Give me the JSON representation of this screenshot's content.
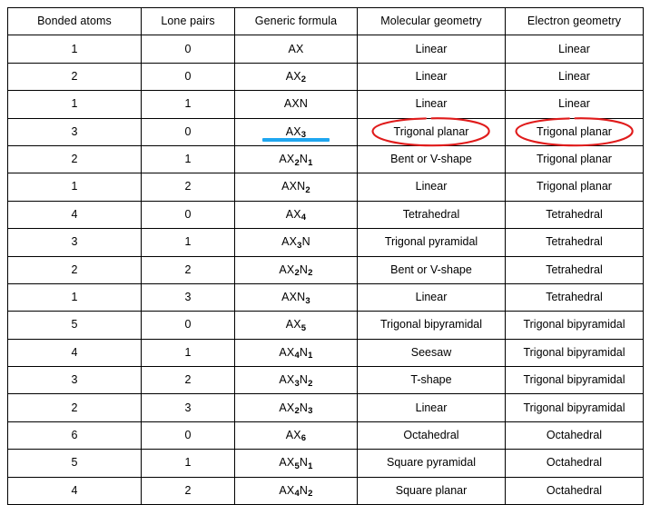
{
  "table": {
    "headers": [
      "Bonded atoms",
      "Lone pairs",
      "Generic formula",
      "Molecular geometry",
      "Electron geometry"
    ],
    "rows": [
      {
        "bonded": "1",
        "lone": "0",
        "formula_base": "AX",
        "formula_sub1": "",
        "formula_mid": "",
        "formula_sub2": "",
        "molecular": "Linear",
        "electron": "Linear"
      },
      {
        "bonded": "2",
        "lone": "0",
        "formula_base": "AX",
        "formula_sub1": "2",
        "formula_mid": "",
        "formula_sub2": "",
        "molecular": "Linear",
        "electron": "Linear"
      },
      {
        "bonded": "1",
        "lone": "1",
        "formula_base": "AX",
        "formula_sub1": "",
        "formula_mid": "N",
        "formula_sub2": "",
        "molecular": "Linear",
        "electron": "Linear"
      },
      {
        "bonded": "3",
        "lone": "0",
        "formula_base": "AX",
        "formula_sub1": "3",
        "formula_mid": "",
        "formula_sub2": "",
        "molecular": "Trigonal planar",
        "electron": "Trigonal planar"
      },
      {
        "bonded": "2",
        "lone": "1",
        "formula_base": "AX",
        "formula_sub1": "2",
        "formula_mid": "N",
        "formula_sub2": "1",
        "molecular": "Bent or V-shape",
        "electron": "Trigonal planar"
      },
      {
        "bonded": "1",
        "lone": "2",
        "formula_base": "AX",
        "formula_sub1": "",
        "formula_mid": "N",
        "formula_sub2": "2",
        "molecular": "Linear",
        "electron": "Trigonal planar"
      },
      {
        "bonded": "4",
        "lone": "0",
        "formula_base": "AX",
        "formula_sub1": "4",
        "formula_mid": "",
        "formula_sub2": "",
        "molecular": "Tetrahedral",
        "electron": "Tetrahedral"
      },
      {
        "bonded": "3",
        "lone": "1",
        "formula_base": "AX",
        "formula_sub1": "3",
        "formula_mid": "N",
        "formula_sub2": "",
        "molecular": "Trigonal pyramidal",
        "electron": "Tetrahedral"
      },
      {
        "bonded": "2",
        "lone": "2",
        "formula_base": "AX",
        "formula_sub1": "2",
        "formula_mid": "N",
        "formula_sub2": "2",
        "molecular": "Bent or V-shape",
        "electron": "Tetrahedral"
      },
      {
        "bonded": "1",
        "lone": "3",
        "formula_base": "AX",
        "formula_sub1": "",
        "formula_mid": "N",
        "formula_sub2": "3",
        "molecular": "Linear",
        "electron": "Tetrahedral"
      },
      {
        "bonded": "5",
        "lone": "0",
        "formula_base": "AX",
        "formula_sub1": "5",
        "formula_mid": "",
        "formula_sub2": "",
        "molecular": "Trigonal bipyramidal",
        "electron": "Trigonal bipyramidal"
      },
      {
        "bonded": "4",
        "lone": "1",
        "formula_base": "AX",
        "formula_sub1": "4",
        "formula_mid": "N",
        "formula_sub2": "1",
        "molecular": "Seesaw",
        "electron": "Trigonal bipyramidal"
      },
      {
        "bonded": "3",
        "lone": "2",
        "formula_base": "AX",
        "formula_sub1": "3",
        "formula_mid": "N",
        "formula_sub2": "2",
        "molecular": "T-shape",
        "electron": "Trigonal bipyramidal"
      },
      {
        "bonded": "2",
        "lone": "3",
        "formula_base": "AX",
        "formula_sub1": "2",
        "formula_mid": "N",
        "formula_sub2": "3",
        "molecular": "Linear",
        "electron": "Trigonal bipyramidal"
      },
      {
        "bonded": "6",
        "lone": "0",
        "formula_base": "AX",
        "formula_sub1": "6",
        "formula_mid": "",
        "formula_sub2": "",
        "molecular": "Octahedral",
        "electron": "Octahedral"
      },
      {
        "bonded": "5",
        "lone": "1",
        "formula_base": "AX",
        "formula_sub1": "5",
        "formula_mid": "N",
        "formula_sub2": "1",
        "molecular": "Square pyramidal",
        "electron": "Octahedral"
      },
      {
        "bonded": "4",
        "lone": "2",
        "formula_base": "AX",
        "formula_sub1": "4",
        "formula_mid": "N",
        "formula_sub2": "2",
        "molecular": "Square planar",
        "electron": "Octahedral"
      }
    ]
  },
  "annotations": {
    "underline": {
      "row_index": 3,
      "column": "formula",
      "color": "#1FA6F0"
    },
    "ellipses": [
      {
        "row_index": 3,
        "column": "molecular",
        "color": "#E01B1B"
      },
      {
        "row_index": 3,
        "column": "electron",
        "color": "#E01B1B"
      }
    ]
  },
  "colors": {
    "header_text": "#0000FF",
    "formula_text": "#FF0000",
    "body_text": "#000000",
    "border": "#000000",
    "highlight_bar": "#1FA6F0",
    "ellipse": "#E01B1B",
    "background": "#FFFFFF"
  }
}
